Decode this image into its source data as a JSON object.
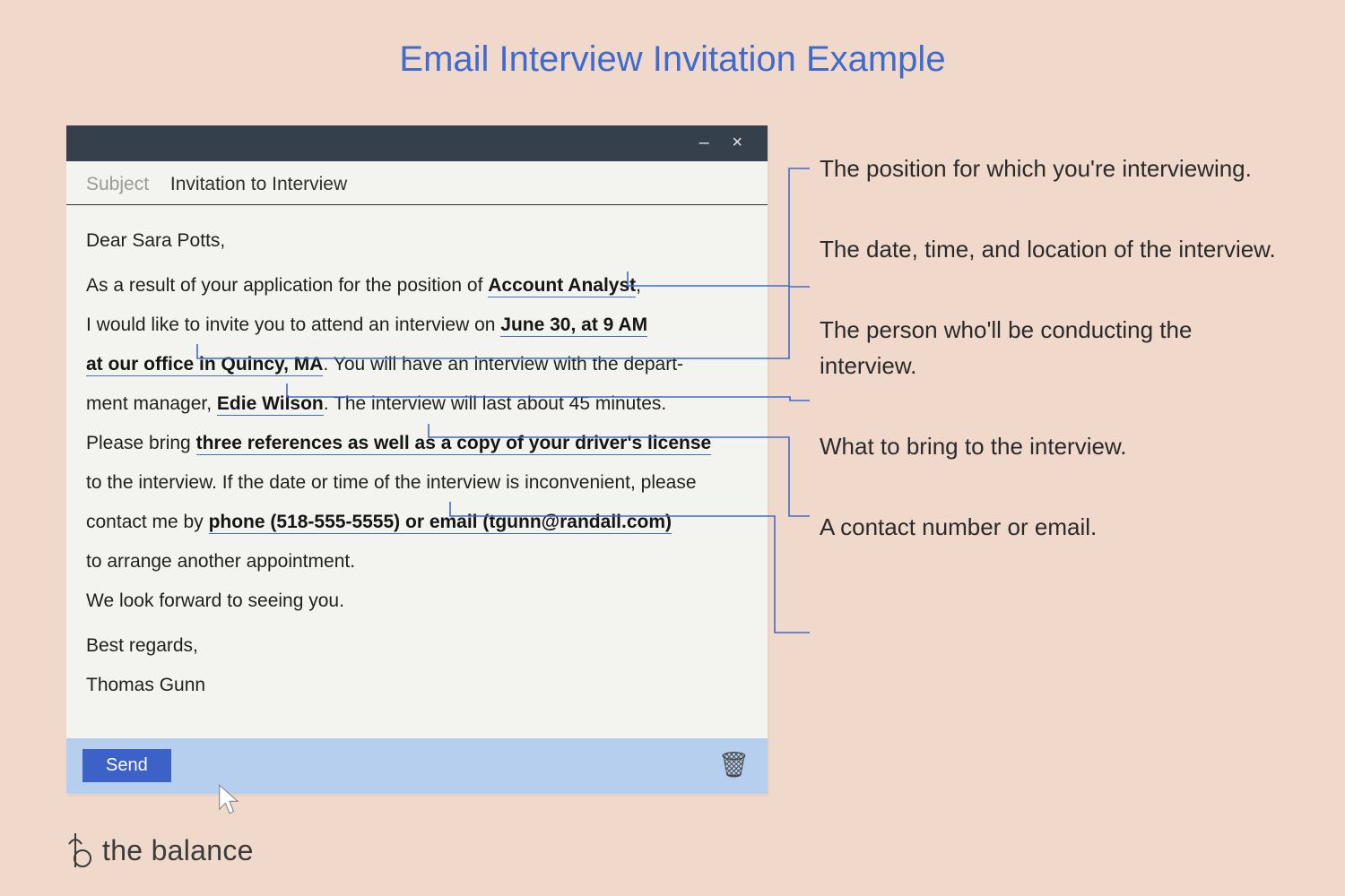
{
  "title": "Email Interview Invitation Example",
  "subject": {
    "label": "Subject",
    "value": "Invitation to Interview"
  },
  "email": {
    "greeting": "Dear Sara Potts,",
    "l1a": "As a result of your application for the position of ",
    "l1b": "Account Analyst",
    "l1c": ",",
    "l2a": "I  would like to invite you to attend an interview on ",
    "l2b": "June 30, at 9 AM",
    "l3a": "at our office in Quincy, MA",
    "l3b": ". You will have an interview with the depart-",
    "l4a": "ment manager, ",
    "l4b": "Edie Wilson",
    "l4c": ". The interview will last about 45 minutes.",
    "l5a": "Please bring ",
    "l5b": "three references as well as a copy of your driver's license",
    "l6": "to the interview. If the date or time of the interview is inconvenient, please",
    "l7a": "contact me by ",
    "l7b": "phone (518-555-5555) or email (tgunn@randall.com)",
    "l8": "to arrange another appointment.",
    "l9": "We look forward to seeing you.",
    "closing1": "Best regards,",
    "closing2": "Thomas Gunn"
  },
  "send": "Send",
  "callouts": [
    "The position for which you're interviewing.",
    "The date, time, and location of the interview.",
    "The person who'll be conducting the interview.",
    "What to bring to the interview.",
    "A contact number or email."
  ],
  "brand": "the balance"
}
